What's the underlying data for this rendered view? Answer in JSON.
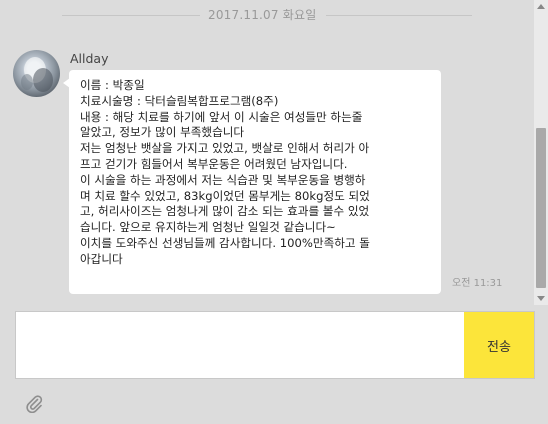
{
  "chat": {
    "date_divider": "2017.11.07 화요일",
    "sender": "Allday",
    "message": "이름 : 박종일\n치료시술명 : 닥터슬림복합프로그램(8주)\n내용 : 해당 치료를 하기에 앞서 이 시술은 여성들만 하는줄\n알았고, 정보가 많이 부족했습니다\n저는 엄청난 뱃살을 가지고 있었고, 뱃살로 인해서 허리가 아\n프고 걷기가 힘들어서 복부운동은 어려웠던 남자입니다.\n이 시술을 하는 과정에서 저는 식습관 및 복부운동을 병행하\n며 치료 할수 있었고, 83kg이었던 몸부게는 80kg정도 되었\n고, 허리사이즈는 엄청나게 많이 감소 되는 효과를 볼수 있었\n습니다. 앞으로 유지하는게 엄청난 일일것 같습니다~\n이치를 도와주신 선생님들께 감사합니다. 100%만족하고 돌\n아갑니다",
    "time": "오전 11:31"
  },
  "composer": {
    "input_value": "",
    "send_label": "전송"
  },
  "icons": {
    "attach": "paperclip-icon",
    "avatar": "profile-photo"
  },
  "colors": {
    "background": "#dcdcdc",
    "bubble": "#ffffff",
    "send_button": "#fce53a"
  }
}
